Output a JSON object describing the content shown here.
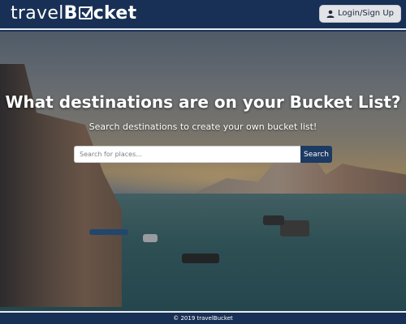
{
  "navbar": {
    "brand_prefix": "travel",
    "brand_b": "B",
    "brand_suffix": "cket",
    "login_label": "Login/Sign Up"
  },
  "hero": {
    "title": "What destinations are on your Bucket List?",
    "subtitle": "Search destinations to create your own bucket list!",
    "search_placeholder": "Search for places...",
    "search_button": "Search"
  },
  "footer": {
    "text": "© 2019 travelBucket"
  },
  "colors": {
    "navbar_bg": "#183055",
    "search_button_bg": "#1d3a63",
    "login_button_bg": "#e1e3e6"
  }
}
